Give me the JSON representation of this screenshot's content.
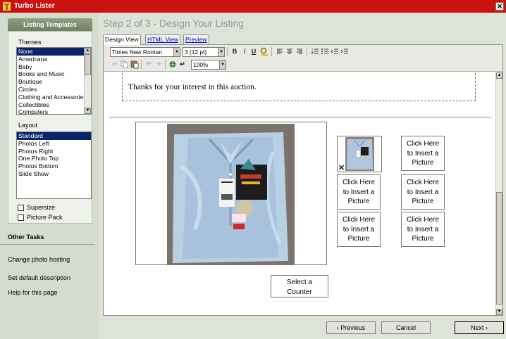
{
  "window": {
    "title": "Turbo Lister"
  },
  "sidebar": {
    "header": "Listing Templates",
    "themes_label": "Themes",
    "themes": [
      "None",
      "Americana",
      "Baby",
      "Books and Music",
      "Boutique",
      "Circles",
      "Clothing and Accessories",
      "Collectibles",
      "Computers"
    ],
    "selected_theme": "None",
    "layout_label": "Layout",
    "layouts": [
      "Standard",
      "Photos Left",
      "Photos Right",
      "One Photo Top",
      "Photos Bottom",
      "Slide Show"
    ],
    "selected_layout": "Standard",
    "checkboxes": {
      "supersize": "Supersize",
      "picture_pack": "Picture Pack"
    },
    "other_tasks": {
      "title": "Other Tasks",
      "links": [
        "Change photo hosting",
        "Set default description",
        "Help for this page"
      ]
    }
  },
  "main": {
    "step_title": "Step 2 of 3 - Design Your Listing",
    "tabs": [
      "Design View",
      "HTML View",
      "Preview"
    ],
    "active_tab": "Design View",
    "toolbar": {
      "font_family": "Times New Roman",
      "font_size": "3 (12 pt)",
      "zoom": "100%",
      "bold": "B",
      "italic": "I",
      "underline": "U"
    },
    "content": {
      "description_text": "Thanks for your interest in this auction.",
      "picture_slot_lines": [
        "Click Here",
        "to Insert a",
        "Picture"
      ],
      "counter_lines": [
        "Select a",
        "Counter"
      ],
      "thumb_remove": "✕"
    },
    "buttons": {
      "previous": "‹ Previous",
      "cancel": "Cancel",
      "next": "Next ›"
    }
  },
  "colors": {
    "titlebar": "#cc1111",
    "selection": "#0a246a",
    "link": "#0000cc"
  }
}
